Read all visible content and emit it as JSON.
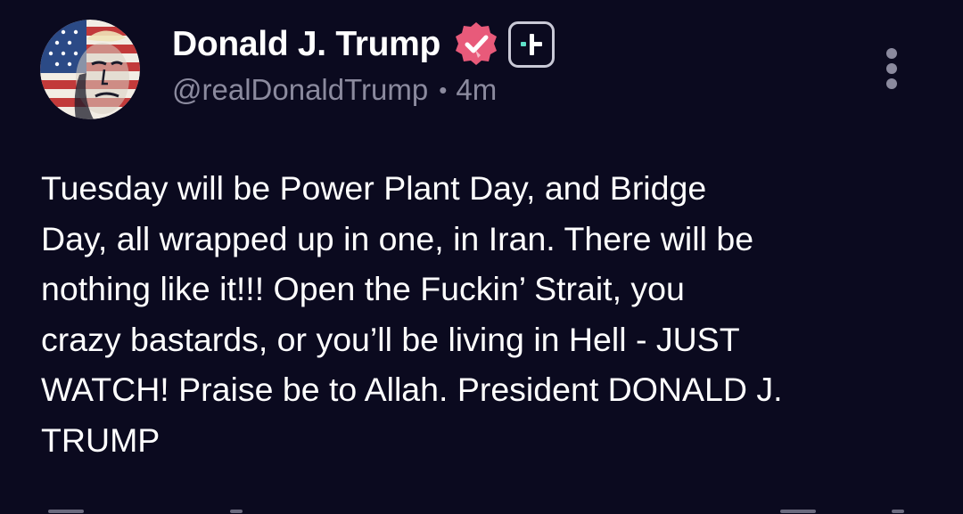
{
  "post": {
    "author": {
      "display_name": "Donald J. Trump",
      "handle": "@realDonaldTrump",
      "verified_icon": "verified-badge-icon",
      "badge_icon": "plus-badge-icon"
    },
    "separator": "•",
    "timestamp": "4m",
    "body": "Tuesday will be Power Plant Day, and Bridge\nDay, all wrapped up in one, in Iran. There will be\nnothing like it!!! Open the Fuckin’ Strait, you\ncrazy bastards, or you’ll be living in Hell - JUST\nWATCH! Praise be to Allah. President DONALD J.\nTRUMP",
    "menu_icon": "more-vertical-icon"
  },
  "colors": {
    "background": "#0b0a1f",
    "text": "#ffffff",
    "muted": "#8b8a9e",
    "verified": "#e85a7a",
    "badge_accent": "#5fe0c8"
  }
}
